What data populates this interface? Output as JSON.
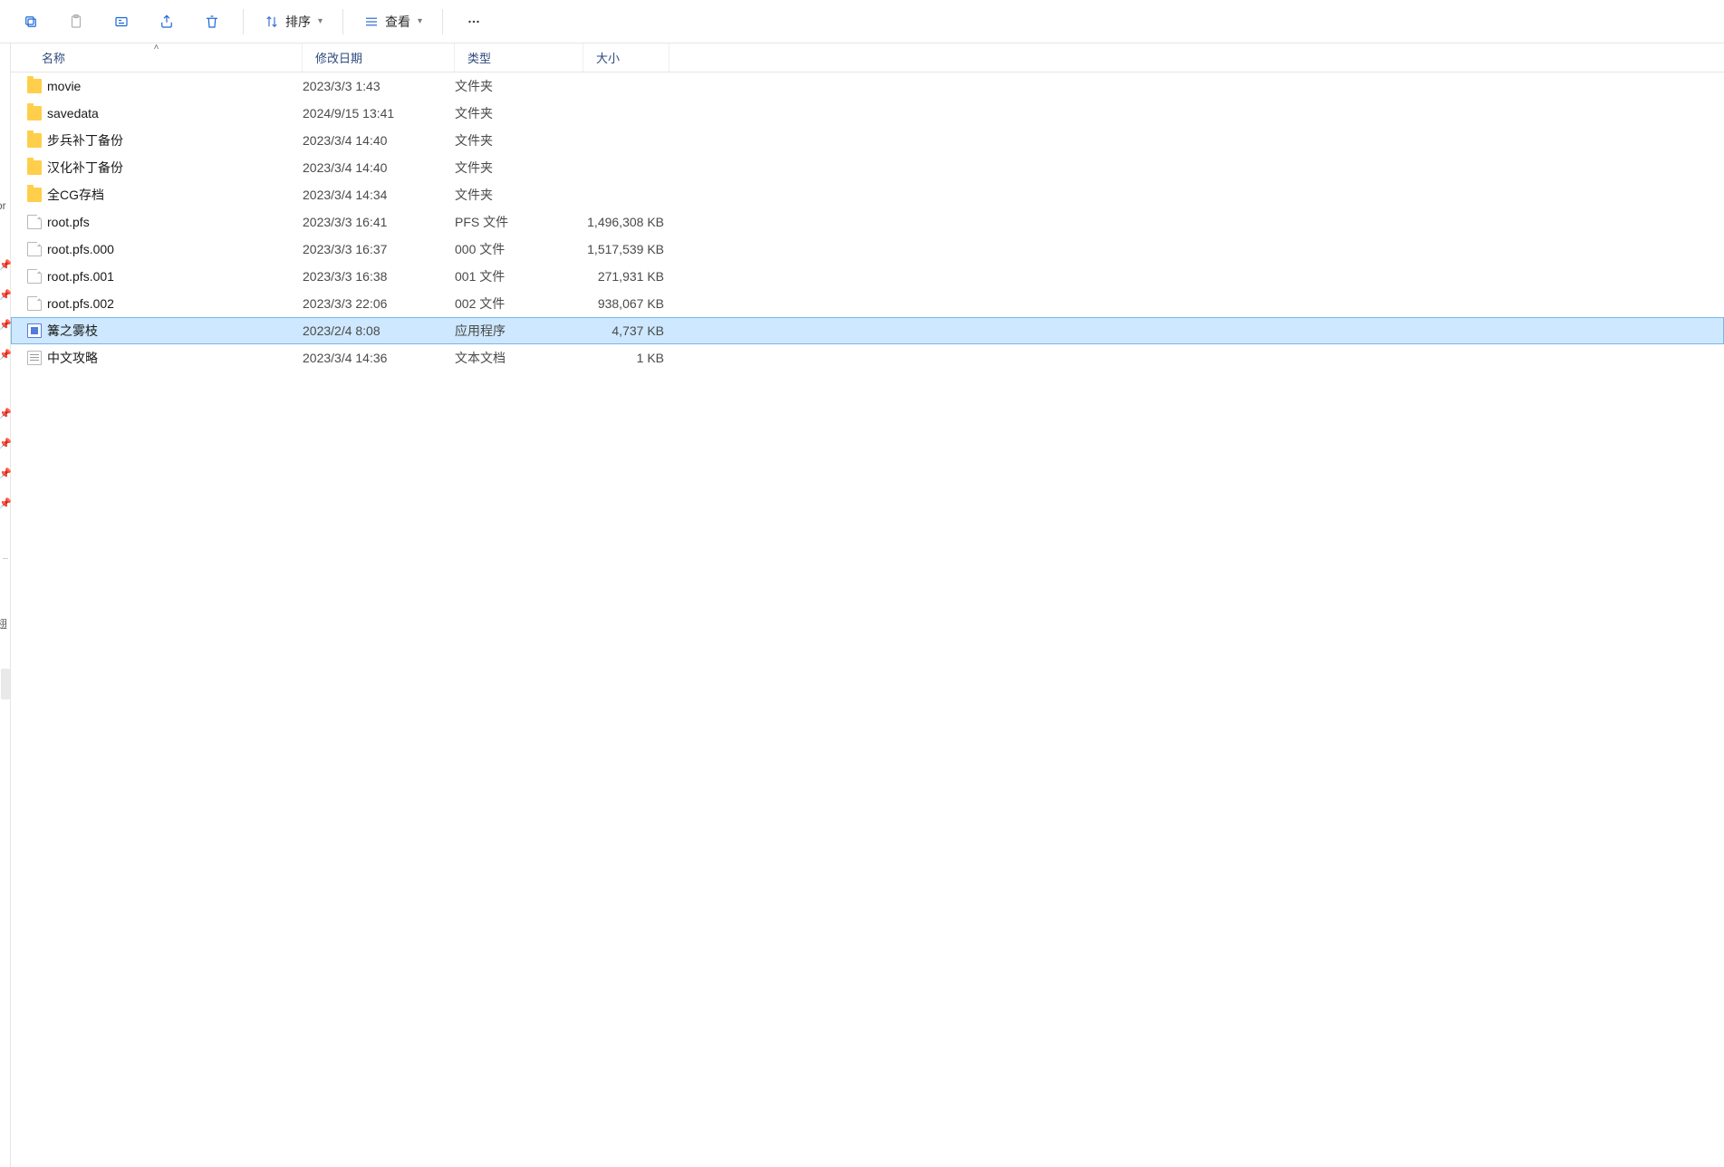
{
  "toolbar": {
    "sort_label": "排序",
    "view_label": "查看"
  },
  "columns": {
    "name": "名称",
    "date": "修改日期",
    "type": "类型",
    "size": "大小"
  },
  "navstrip": {
    "text_or": "or",
    "text_misc": "翅"
  },
  "rows": [
    {
      "icon": "folder",
      "name": "movie",
      "date": "2023/3/3 1:43",
      "type": "文件夹",
      "size": "",
      "selected": false
    },
    {
      "icon": "folder",
      "name": "savedata",
      "date": "2024/9/15 13:41",
      "type": "文件夹",
      "size": "",
      "selected": false
    },
    {
      "icon": "folder",
      "name": "步兵补丁备份",
      "date": "2023/3/4 14:40",
      "type": "文件夹",
      "size": "",
      "selected": false
    },
    {
      "icon": "folder",
      "name": "汉化补丁备份",
      "date": "2023/3/4 14:40",
      "type": "文件夹",
      "size": "",
      "selected": false
    },
    {
      "icon": "folder",
      "name": "全CG存档",
      "date": "2023/3/4 14:34",
      "type": "文件夹",
      "size": "",
      "selected": false
    },
    {
      "icon": "file",
      "name": "root.pfs",
      "date": "2023/3/3 16:41",
      "type": "PFS 文件",
      "size": "1,496,308 KB",
      "selected": false
    },
    {
      "icon": "file",
      "name": "root.pfs.000",
      "date": "2023/3/3 16:37",
      "type": "000 文件",
      "size": "1,517,539 KB",
      "selected": false
    },
    {
      "icon": "file",
      "name": "root.pfs.001",
      "date": "2023/3/3 16:38",
      "type": "001 文件",
      "size": "271,931 KB",
      "selected": false
    },
    {
      "icon": "file",
      "name": "root.pfs.002",
      "date": "2023/3/3 22:06",
      "type": "002 文件",
      "size": "938,067 KB",
      "selected": false
    },
    {
      "icon": "exe",
      "name": "篝之雾枝",
      "date": "2023/2/4 8:08",
      "type": "应用程序",
      "size": "4,737 KB",
      "selected": true
    },
    {
      "icon": "txt",
      "name": "中文攻略",
      "date": "2023/3/4 14:36",
      "type": "文本文档",
      "size": "1 KB",
      "selected": false
    }
  ]
}
